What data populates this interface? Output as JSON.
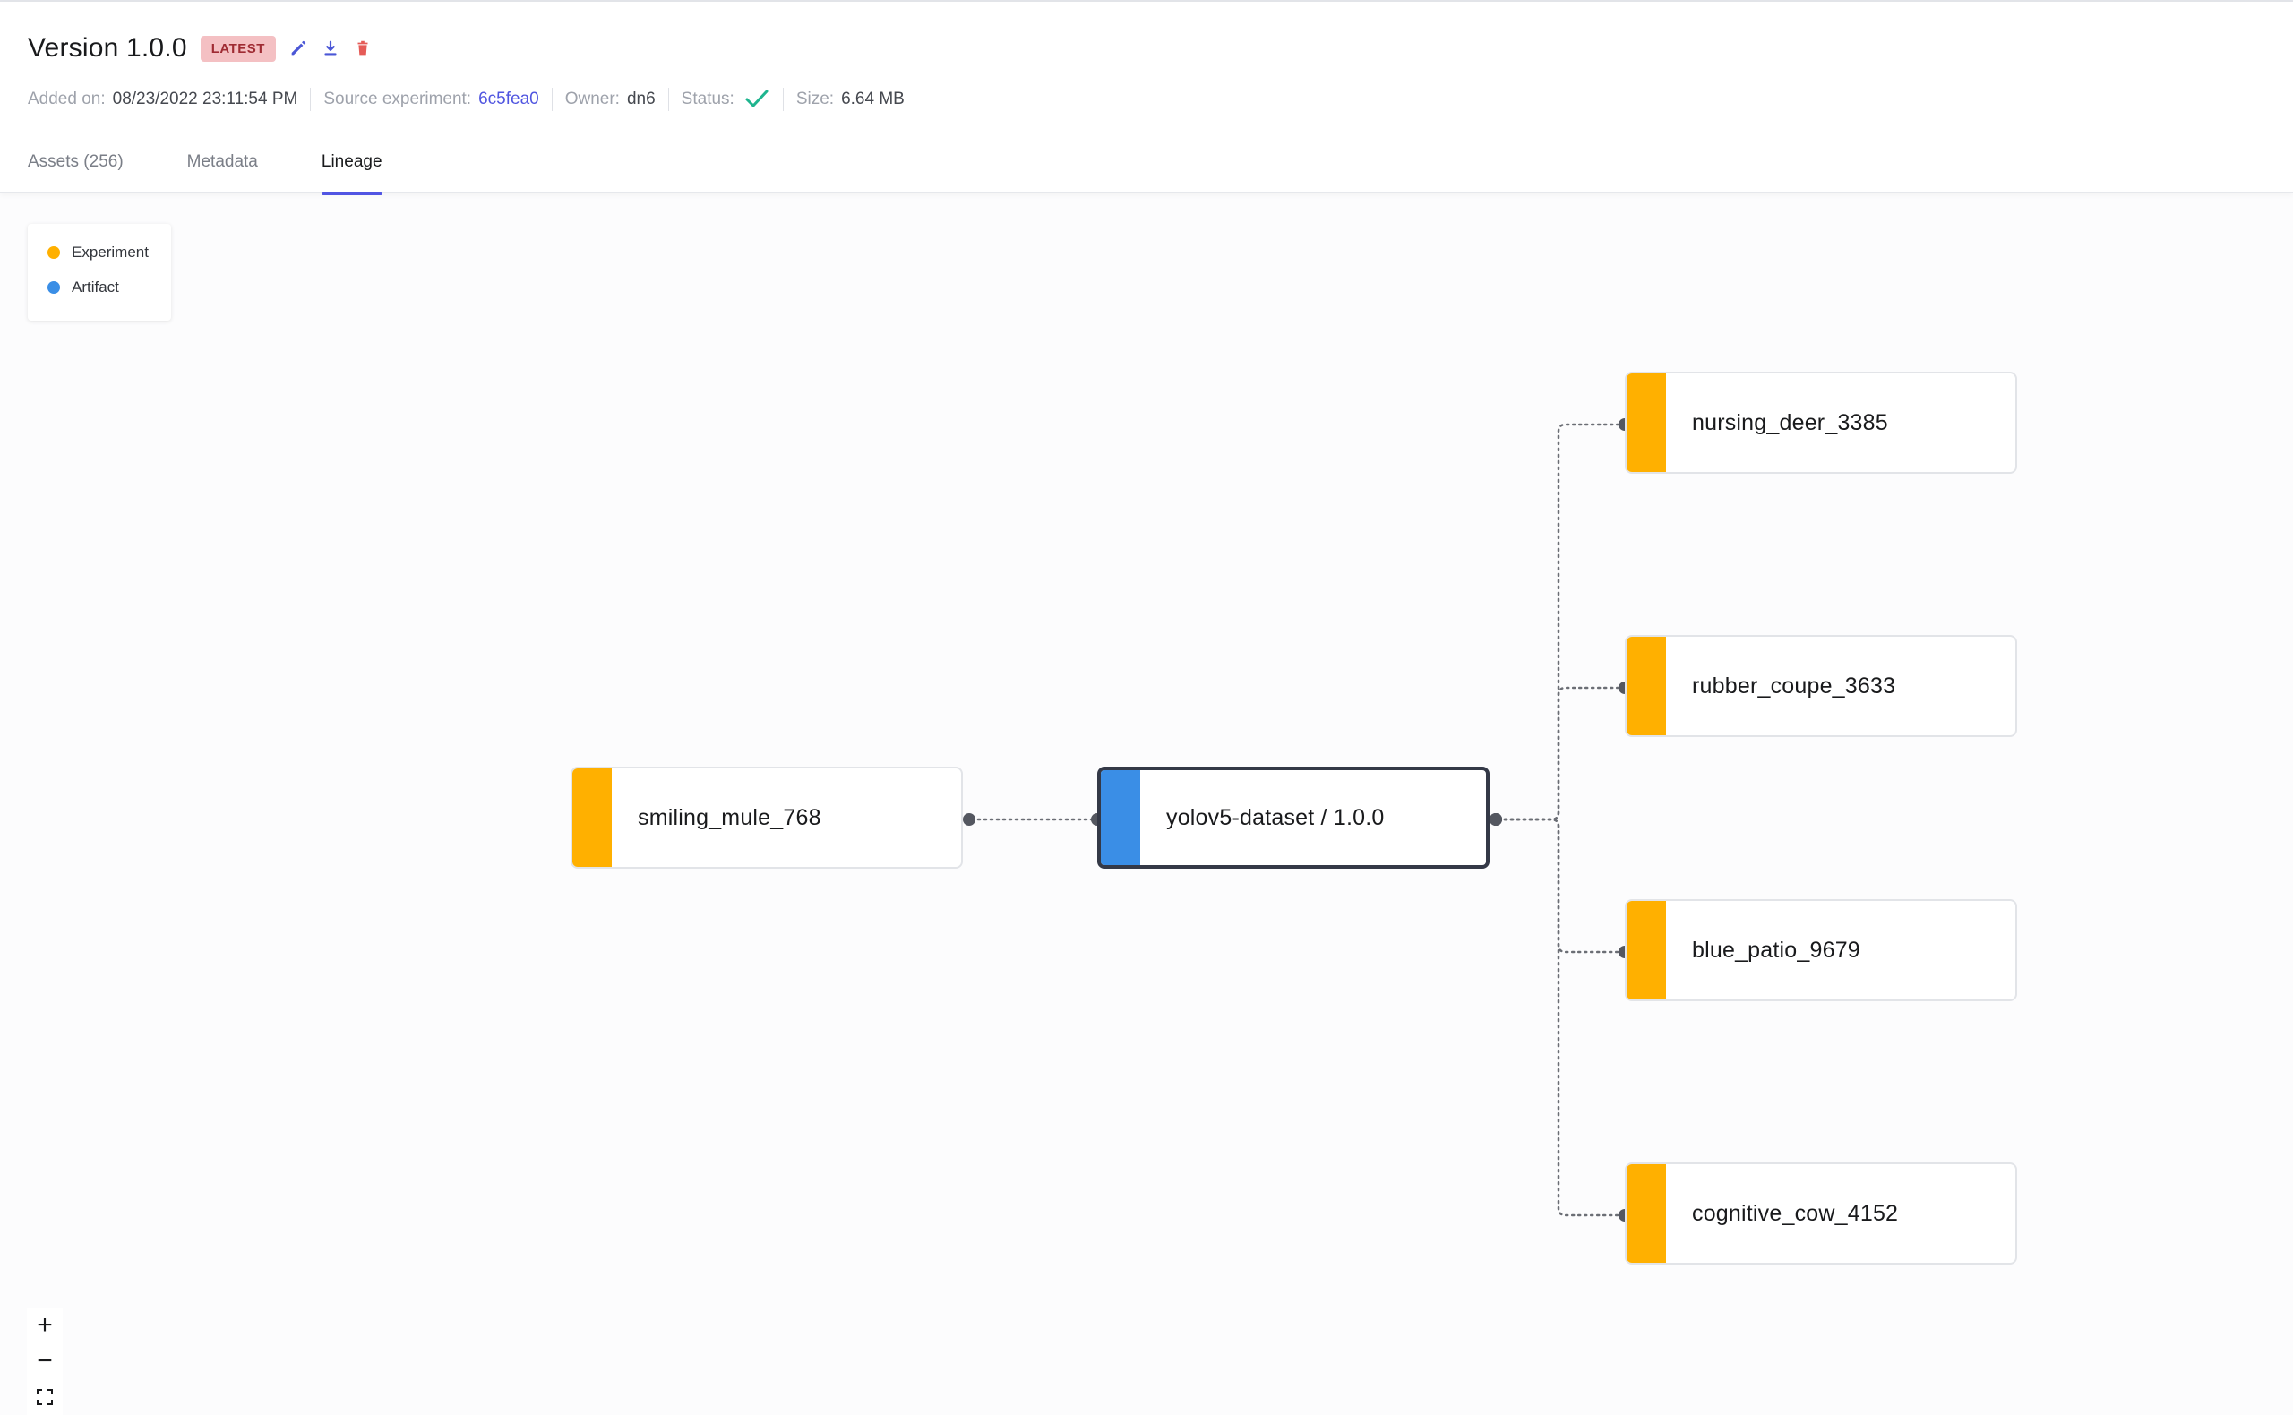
{
  "header": {
    "title": "Version 1.0.0",
    "badge": "LATEST",
    "icons": {
      "edit": "pencil-icon",
      "download": "download-icon",
      "delete": "trash-icon"
    }
  },
  "meta": {
    "added_label": "Added on:",
    "added_value": "08/23/2022 23:11:54 PM",
    "source_label": "Source experiment:",
    "source_value": "6c5fea0",
    "owner_label": "Owner:",
    "owner_value": "dn6",
    "status_label": "Status:",
    "status_icon": "check-icon",
    "size_label": "Size:",
    "size_value": "6.64 MB"
  },
  "tabs": [
    {
      "label": "Assets (256)",
      "active": false
    },
    {
      "label": "Metadata",
      "active": false
    },
    {
      "label": "Lineage",
      "active": true
    }
  ],
  "legend": [
    {
      "label": "Experiment",
      "color": "#ffb000"
    },
    {
      "label": "Artifact",
      "color": "#3a8ee6"
    }
  ],
  "graph": {
    "colors": {
      "experiment": "#ffb000",
      "artifact": "#3a8ee6",
      "edge": "#6b6e75",
      "handle": "#545760"
    },
    "nodes": [
      {
        "id": "smiling_mule_768",
        "label": "smiling_mule_768",
        "kind": "experiment"
      },
      {
        "id": "yolov5",
        "label": "yolov5-dataset / 1.0.0",
        "kind": "artifact",
        "selected": true
      },
      {
        "id": "nursing_deer_3385",
        "label": "nursing_deer_3385",
        "kind": "experiment"
      },
      {
        "id": "rubber_coupe_3633",
        "label": "rubber_coupe_3633",
        "kind": "experiment"
      },
      {
        "id": "blue_patio_9679",
        "label": "blue_patio_9679",
        "kind": "experiment"
      },
      {
        "id": "cognitive_cow_4152",
        "label": "cognitive_cow_4152",
        "kind": "experiment"
      }
    ],
    "edges": [
      [
        "smiling_mule_768",
        "yolov5"
      ],
      [
        "yolov5",
        "nursing_deer_3385"
      ],
      [
        "yolov5",
        "rubber_coupe_3633"
      ],
      [
        "yolov5",
        "blue_patio_9679"
      ],
      [
        "yolov5",
        "cognitive_cow_4152"
      ]
    ]
  },
  "zoom": {
    "in": "+",
    "out": "−",
    "fit": "fit-view-icon"
  }
}
